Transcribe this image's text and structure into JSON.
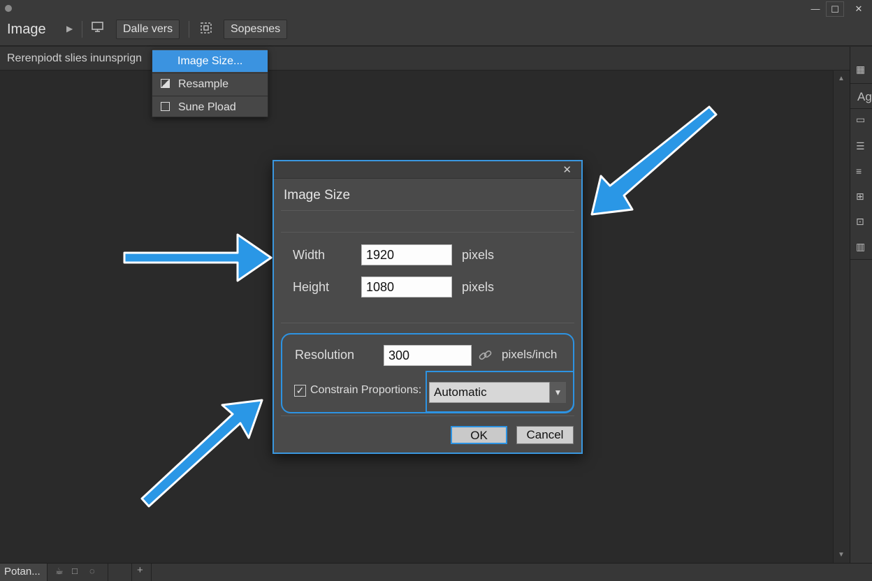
{
  "topbar": {
    "app_title": "Image",
    "button1_label": "Dalle vers",
    "button2_label": "Sopesnes",
    "win_controls": [
      "—",
      "☐",
      "✕"
    ]
  },
  "subbar": {
    "text": "Rerenpiodt slies inunsprign"
  },
  "menu": {
    "items": [
      {
        "label": "Image Size...",
        "active": true
      },
      {
        "label": "Resample"
      },
      {
        "label": "Sune Pload"
      }
    ]
  },
  "right_panel": {
    "label": "Ag"
  },
  "bottombar": {
    "tab_label": "Potan..."
  },
  "dialog": {
    "title": "Image Size",
    "close": "✕",
    "width_label": "Width",
    "width_value": "1920",
    "width_unit": "pixels",
    "height_label": "Height",
    "height_value": "1080",
    "height_unit": "pixels",
    "resolution_label": "Resolution",
    "resolution_value": "300",
    "resolution_unit": "pixels/inch",
    "constrain_label": "Constrain Proportions:",
    "constrain_checked": true,
    "resample_selected": "Automatic",
    "ok_label": "OK",
    "cancel_label": "Cancel"
  },
  "colors": {
    "accent": "#2d93e2",
    "menu_highlight": "#3b93e0",
    "background": "#2b2b2b",
    "dialog": "#4a4a4a"
  }
}
